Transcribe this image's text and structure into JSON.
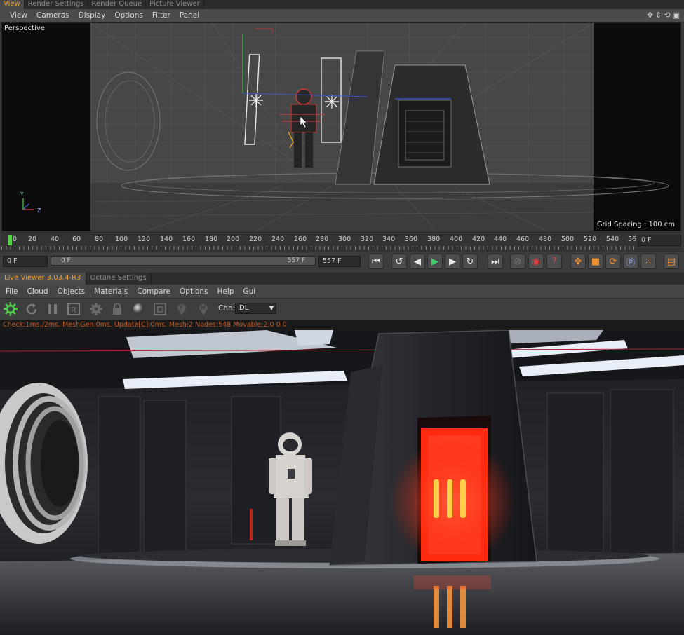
{
  "top_tabs": [
    "View",
    "Render Settings",
    "Render Queue",
    "Picture Viewer"
  ],
  "viewport_menu": [
    "View",
    "Cameras",
    "Display",
    "Options",
    "Filter",
    "Panel"
  ],
  "viewport": {
    "name": "Perspective",
    "grid_spacing": "Grid Spacing : 100 cm",
    "axis_y": "Y",
    "axis_z": "Z"
  },
  "timeline": {
    "ruler_labels": [
      "0",
      "20",
      "40",
      "60",
      "80",
      "100",
      "120",
      "140",
      "160",
      "180",
      "200",
      "220",
      "240",
      "260",
      "280",
      "300",
      "320",
      "340",
      "360",
      "380",
      "400",
      "420",
      "440",
      "460",
      "480",
      "500",
      "520",
      "540",
      "56"
    ],
    "current_frame": "0 F"
  },
  "transport": {
    "start_field": "0 F",
    "slider_left": "0 F",
    "slider_right": "557 F",
    "end_field": "557 F"
  },
  "octane_tabs": [
    "Live Viewer 3.03.4-R3",
    "Octane Settings"
  ],
  "octane_menu": [
    "File",
    "Cloud",
    "Objects",
    "Materials",
    "Compare",
    "Options",
    "Help",
    "Gui"
  ],
  "octane_toolbar": {
    "channel_label": "Chn:",
    "channel_value": "DL"
  },
  "status": "Check:1ms./2ms. MeshGen:0ms. Update[C]:0ms. Mesh:2 Nodes:548 Movable:2:0 0 0",
  "colors": {
    "accent": "#f0a030",
    "playhead": "#56d04a",
    "status_text": "#c25a22"
  }
}
